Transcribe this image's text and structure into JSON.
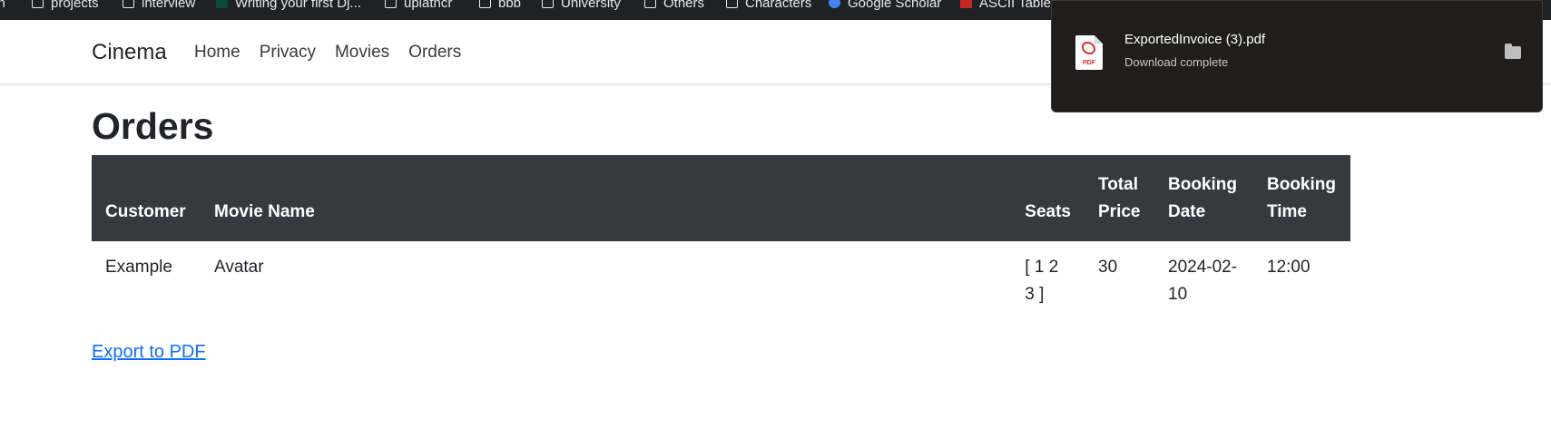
{
  "bookmarks": [
    {
      "label": "ith",
      "icon": "folder-icon"
    },
    {
      "label": "projects",
      "icon": "folder-icon"
    },
    {
      "label": "interview",
      "icon": "folder-icon"
    },
    {
      "label": "Writing your first Dj...",
      "icon": "django-icon"
    },
    {
      "label": "uplatncr",
      "icon": "folder-icon"
    },
    {
      "label": "bbb",
      "icon": "folder-icon"
    },
    {
      "label": "University",
      "icon": "folder-icon"
    },
    {
      "label": "Others",
      "icon": "folder-icon"
    },
    {
      "label": "Characters",
      "icon": "folder-icon"
    },
    {
      "label": "Google Scholar",
      "icon": "scholar-icon"
    },
    {
      "label": "ASCII Table",
      "icon": "ascii-table-icon"
    }
  ],
  "navbar": {
    "brand": "Cinema",
    "links": [
      "Home",
      "Privacy",
      "Movies",
      "Orders"
    ]
  },
  "page": {
    "title": "Orders"
  },
  "orders_table": {
    "headers": {
      "customer": "Customer",
      "movie_name": "Movie Name",
      "seats": "Seats",
      "total_price": "Total Price",
      "booking_date": "Booking Date",
      "booking_time": "Booking Time"
    },
    "rows": [
      {
        "customer": "Example",
        "movie_name": "Avatar",
        "seats": "[ 1 2 3 ]",
        "total_price": "30",
        "booking_date": "2024-02-10",
        "booking_time": "12:00"
      }
    ]
  },
  "export_link": "Export to PDF",
  "download": {
    "file_name": "ExportedInvoice (3).pdf",
    "status": "Download complete",
    "icon": "pdf-icon",
    "action_icon": "folder-icon"
  },
  "colors": {
    "navbar_header_bg": "#343a40",
    "link": "#0d6efd",
    "popup_bg": "#1f1e1c",
    "bookmarks_bg": "#202124"
  }
}
